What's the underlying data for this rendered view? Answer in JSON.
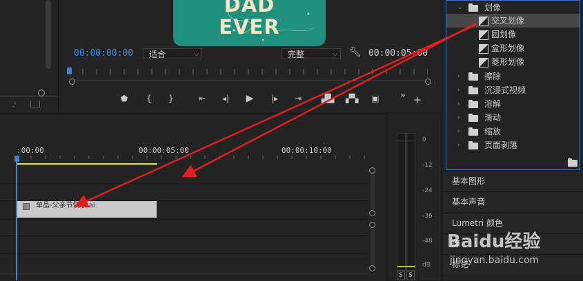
{
  "program": {
    "video_text": "DAD\nEVER",
    "timecode_current": "00:00:00:00",
    "fit_select": "适合",
    "quality_select": "完整",
    "timecode_duration": "00:00:05:00"
  },
  "timeline": {
    "ruler_labels": [
      ":00:00",
      "00:00:05:00",
      "00:00:10:00"
    ],
    "clip_label": "单品-父亲节快乐.ai"
  },
  "meter": {
    "db_ticks": [
      "0",
      "-12",
      "-24",
      "-36",
      "-48",
      "dB"
    ],
    "solo_labels": [
      "S",
      "S"
    ]
  },
  "effects_tree": {
    "parent": "划像",
    "items": [
      "交叉划像",
      "圆划像",
      "盒形划像",
      "菱形划像"
    ],
    "folders": [
      "擦除",
      "沉浸式视频",
      "溶解",
      "滑动",
      "缩放",
      "页面剥落"
    ]
  },
  "panels": {
    "essential_graphics": "基本图形",
    "essential_sound": "基本声音",
    "lumetri": "Lumetri 颜色",
    "library": "库",
    "markers": "标记"
  },
  "watermark": {
    "brand": "Baidu经验",
    "url": "jingyan.baidu.com"
  },
  "colors": {
    "accent_blue": "#3f7fd8",
    "arrow_red": "#e02020",
    "in_out_yellow": "#e8e032",
    "video_bg": "#1f8f7e"
  }
}
